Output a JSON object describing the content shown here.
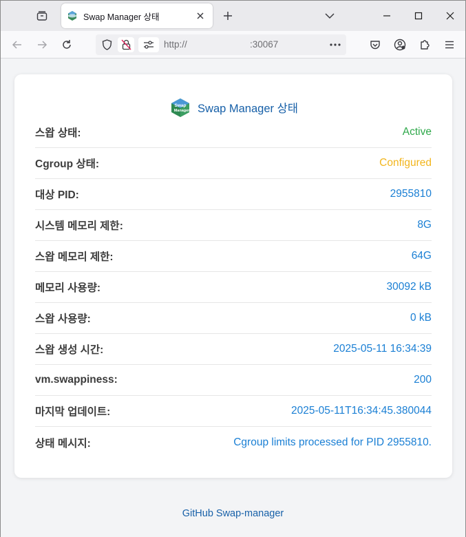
{
  "browser": {
    "tab_title": "Swap Manager 상태",
    "url_scheme": "http://",
    "url_port": ":30067"
  },
  "page": {
    "title": "Swap Manager 상태",
    "logo_text": "Swap Manager",
    "rows": [
      {
        "label": "스왑 상태:",
        "value": "Active",
        "color": "#2ea84a"
      },
      {
        "label": "Cgroup 상태:",
        "value": "Configured",
        "color": "#f2b51c"
      },
      {
        "label": "대상 PID:",
        "value": "2955810",
        "color": "#1a7fd4"
      },
      {
        "label": "시스템 메모리 제한:",
        "value": "8G",
        "color": "#1a7fd4"
      },
      {
        "label": "스왑 메모리 제한:",
        "value": "64G",
        "color": "#1a7fd4"
      },
      {
        "label": "메모리 사용량:",
        "value": "30092 kB",
        "color": "#1a7fd4"
      },
      {
        "label": "스왑 사용량:",
        "value": "0 kB",
        "color": "#1a7fd4"
      },
      {
        "label": "스왑 생성 시간:",
        "value": "2025-05-11 16:34:39",
        "color": "#1a7fd4"
      },
      {
        "label": "vm.swappiness:",
        "value": "200",
        "color": "#1a7fd4"
      },
      {
        "label": "마지막 업데이트:",
        "value": "2025-05-11T16:34:45.380044",
        "color": "#1a7fd4"
      },
      {
        "label": "상태 메시지:",
        "value": "Cgroup limits processed for PID 2955810.",
        "color": "#1a7fd4"
      }
    ],
    "footer_link": "GitHub Swap-manager"
  }
}
